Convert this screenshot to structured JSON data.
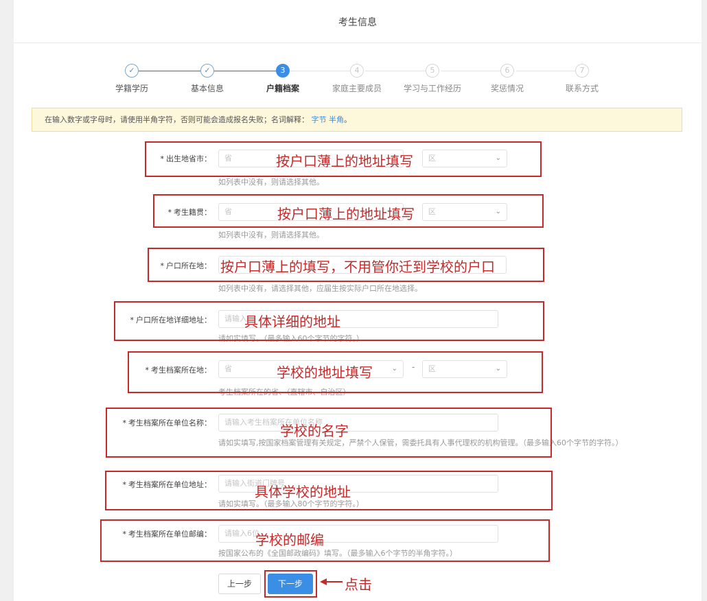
{
  "page": {
    "title": "考生信息"
  },
  "steps": [
    {
      "label": "学籍学历",
      "mark": "✓",
      "state": "done"
    },
    {
      "label": "基本信息",
      "mark": "✓",
      "state": "done"
    },
    {
      "label": "户籍档案",
      "mark": "3",
      "state": "active"
    },
    {
      "label": "家庭主要成员",
      "mark": "4",
      "state": "todo"
    },
    {
      "label": "学习与工作经历",
      "mark": "5",
      "state": "todo"
    },
    {
      "label": "奖惩情况",
      "mark": "6",
      "state": "todo"
    },
    {
      "label": "联系方式",
      "mark": "7",
      "state": "todo"
    }
  ],
  "notice": {
    "text": "在输入数字或字母时，请使用半角字符，否则可能会造成报名失败；名词解释：",
    "link1": "字节",
    "link2": "半角",
    "end": "。"
  },
  "form": {
    "birthplace": {
      "label": "出生地省市：",
      "province_placeholder": "省",
      "district_placeholder": "区",
      "hint": "如列表中没有，则请选择其他。"
    },
    "native_place": {
      "label": "考生籍贯：",
      "province_placeholder": "省",
      "district_placeholder": "区",
      "hint": "如列表中没有，则请选择其他。"
    },
    "hukou_location": {
      "label": "户口所在地：",
      "hint": "如列表中没有，请选择其他，应届生按实际户口所在地选择。"
    },
    "hukou_address": {
      "label": "户口所在地详细地址：",
      "placeholder": "请输入",
      "hint": "请如实填写。（最多输入60个字节的字符。）"
    },
    "archive_location": {
      "label": "考生档案所在地：",
      "province_placeholder": "省",
      "dash": "-",
      "district_placeholder": "区",
      "hint": "考生档案所在的省、（直辖市、自治区）"
    },
    "archive_unit_name": {
      "label": "考生档案所在单位名称：",
      "placeholder": "请输入考生档案所在单位名称",
      "hint": "请如实填写,按国家档案管理有关规定，严禁个人保管，需委托具有人事代理权的机构管理。（最多输入60个字节的字符。）"
    },
    "archive_unit_address": {
      "label": "考生档案所在单位地址：",
      "placeholder": "请输入街道门牌号",
      "hint": "请如实填写。（最多输入80个字节的字符。）"
    },
    "archive_unit_postcode": {
      "label": "考生档案所在单位邮编：",
      "placeholder": "请输入6位",
      "hint": "按国家公布的《全国邮政编码》填写。（最多输入6个字节的半角字符。）"
    }
  },
  "annotations": {
    "birthplace": "按户口薄上的地址填写",
    "native_place": "按户口薄上的地址填写",
    "hukou_location": "按户口薄上的填写，不用管你迁到学校的户口",
    "hukou_address": "具体详细的地址",
    "archive_location": "学校的地址填写",
    "archive_unit_name": "学校的名字",
    "archive_unit_address": "具体学校的地址",
    "archive_unit_postcode": "学校的邮编",
    "click": "点击"
  },
  "buttons": {
    "prev": "上一步",
    "next": "下一步"
  },
  "colors": {
    "accent": "#3a8ee6",
    "annotation": "#c42a2a",
    "notice_bg": "#fdf7dc"
  }
}
